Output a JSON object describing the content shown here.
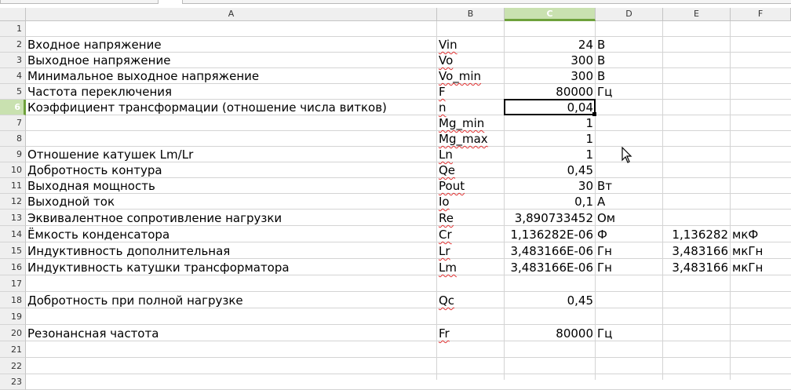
{
  "columns": [
    "A",
    "B",
    "C",
    "D",
    "E",
    "F"
  ],
  "selected_column": "C",
  "selected_row": "6",
  "rows": [
    {
      "num": "1",
      "a": "",
      "b": "",
      "c": "",
      "d": "",
      "e": "",
      "f": ""
    },
    {
      "num": "2",
      "a": "Входное напряжение",
      "b": "Vin",
      "c": "24",
      "d": "В",
      "e": "",
      "f": ""
    },
    {
      "num": "3",
      "a": "Выходное напряжение",
      "b": "Vo",
      "c": "300",
      "d": "В",
      "e": "",
      "f": ""
    },
    {
      "num": "4",
      "a": "Минимальное выходное напряжение",
      "b": "Vo_min",
      "c": "300",
      "d": "В",
      "e": "",
      "f": ""
    },
    {
      "num": "5",
      "a": "Частота переключения",
      "b": "F",
      "c": "80000",
      "d": "Гц",
      "e": "",
      "f": ""
    },
    {
      "num": "6",
      "a": "Коэффициент трансформации (отношение числа витков)",
      "b": "n",
      "c": "0,04",
      "d": "",
      "e": "",
      "f": ""
    },
    {
      "num": "7",
      "a": "",
      "b": "Mg_min",
      "c": "1",
      "d": "",
      "e": "",
      "f": ""
    },
    {
      "num": "8",
      "a": "",
      "b": "Mg_max",
      "c": "1",
      "d": "",
      "e": "",
      "f": ""
    },
    {
      "num": "9",
      "a": "Отношение катушек Lm/Lr",
      "b": "Ln",
      "c": "1",
      "d": "",
      "e": "",
      "f": ""
    },
    {
      "num": "10",
      "a": "Добротность контура",
      "b": "Qe",
      "c": "0,45",
      "d": "",
      "e": "",
      "f": ""
    },
    {
      "num": "11",
      "a": "Выходная мощность",
      "b": "Pout",
      "c": "30",
      "d": "Вт",
      "e": "",
      "f": ""
    },
    {
      "num": "12",
      "a": "Выходной ток",
      "b": "Io",
      "c": "0,1",
      "d": "А",
      "e": "",
      "f": ""
    },
    {
      "num": "13",
      "a": "Эквивалентное сопротивление нагрузки",
      "b": "Re",
      "c": "3,890733452",
      "d": "Ом",
      "e": "",
      "f": ""
    },
    {
      "num": "14",
      "a": "Ёмкость конденсатора",
      "b": "Cr",
      "c": "1,136282E-06",
      "d": "Ф",
      "e": "1,136282",
      "f": "мкФ"
    },
    {
      "num": "15",
      "a": "Индуктивность дополнительная",
      "b": "Lr",
      "c": "3,483166E-06",
      "d": "Гн",
      "e": "3,483166",
      "f": "мкГн"
    },
    {
      "num": "16",
      "a": "Индуктивность катушки трансформатора",
      "b": "Lm",
      "c": "3,483166E-06",
      "d": "Гн",
      "e": "3,483166",
      "f": "мкГн"
    },
    {
      "num": "17",
      "a": "",
      "b": "",
      "c": "",
      "d": "",
      "e": "",
      "f": ""
    },
    {
      "num": "18",
      "a": "Добротность при полной нагрузке",
      "b": "Qc",
      "c": "0,45",
      "d": "",
      "e": "",
      "f": ""
    },
    {
      "num": "19",
      "a": "",
      "b": "",
      "c": "",
      "d": "",
      "e": "",
      "f": ""
    },
    {
      "num": "20",
      "a": "Резонансная частота",
      "b": "Fr",
      "c": "80000",
      "d": "Гц",
      "e": "",
      "f": ""
    },
    {
      "num": "21",
      "a": "",
      "b": "",
      "c": "",
      "d": "",
      "e": "",
      "f": ""
    },
    {
      "num": "22",
      "a": "",
      "b": "",
      "c": "",
      "d": "",
      "e": "",
      "f": ""
    },
    {
      "num": "23",
      "a": "",
      "b": "",
      "c": "",
      "d": "",
      "e": "",
      "f": ""
    }
  ]
}
